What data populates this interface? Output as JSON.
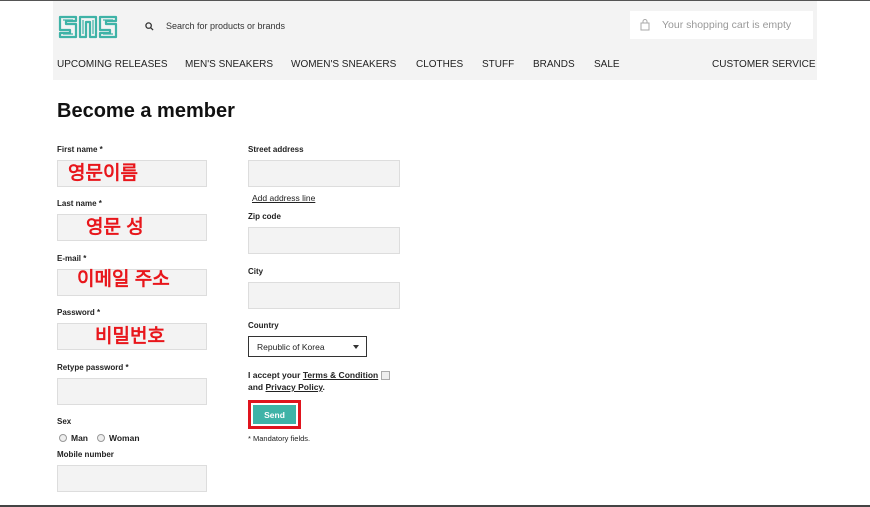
{
  "header": {
    "logo_text": "SNS",
    "search_placeholder": "Search for products or brands",
    "cart_text": "Your shopping cart is empty"
  },
  "nav": {
    "items": [
      "UPCOMING RELEASES",
      "MEN'S SNEAKERS",
      "WOMEN'S SNEAKERS",
      "CLOTHES",
      "STUFF",
      "BRANDS",
      "SALE"
    ],
    "customer_service": "CUSTOMER SERVICE"
  },
  "page_title": "Become a member",
  "left_form": {
    "first_name_label": "First name *",
    "first_name_note": "영문이름",
    "last_name_label": "Last name *",
    "last_name_note": "영문 성",
    "email_label": "E-mail *",
    "email_note": "이메일 주소",
    "password_label": "Password *",
    "password_note": "비밀번호",
    "retype_label": "Retype password *",
    "sex_label": "Sex",
    "sex_options": [
      "Man",
      "Woman"
    ],
    "mobile_label": "Mobile number"
  },
  "right_form": {
    "street_label": "Street address",
    "add_line_link": "Add address line",
    "zip_label": "Zip code",
    "city_label": "City",
    "country_label": "Country",
    "country_value": "Republic of Korea",
    "accept_prefix": "I accept your",
    "terms_link": "Terms & Condition",
    "accept_and": "and",
    "privacy_link": "Privacy Policy",
    "send_label": "Send",
    "mandatory_note": "* Mandatory fields."
  },
  "colors": {
    "brand_teal": "#3fb3a7",
    "annotation_red": "#e8161b"
  }
}
